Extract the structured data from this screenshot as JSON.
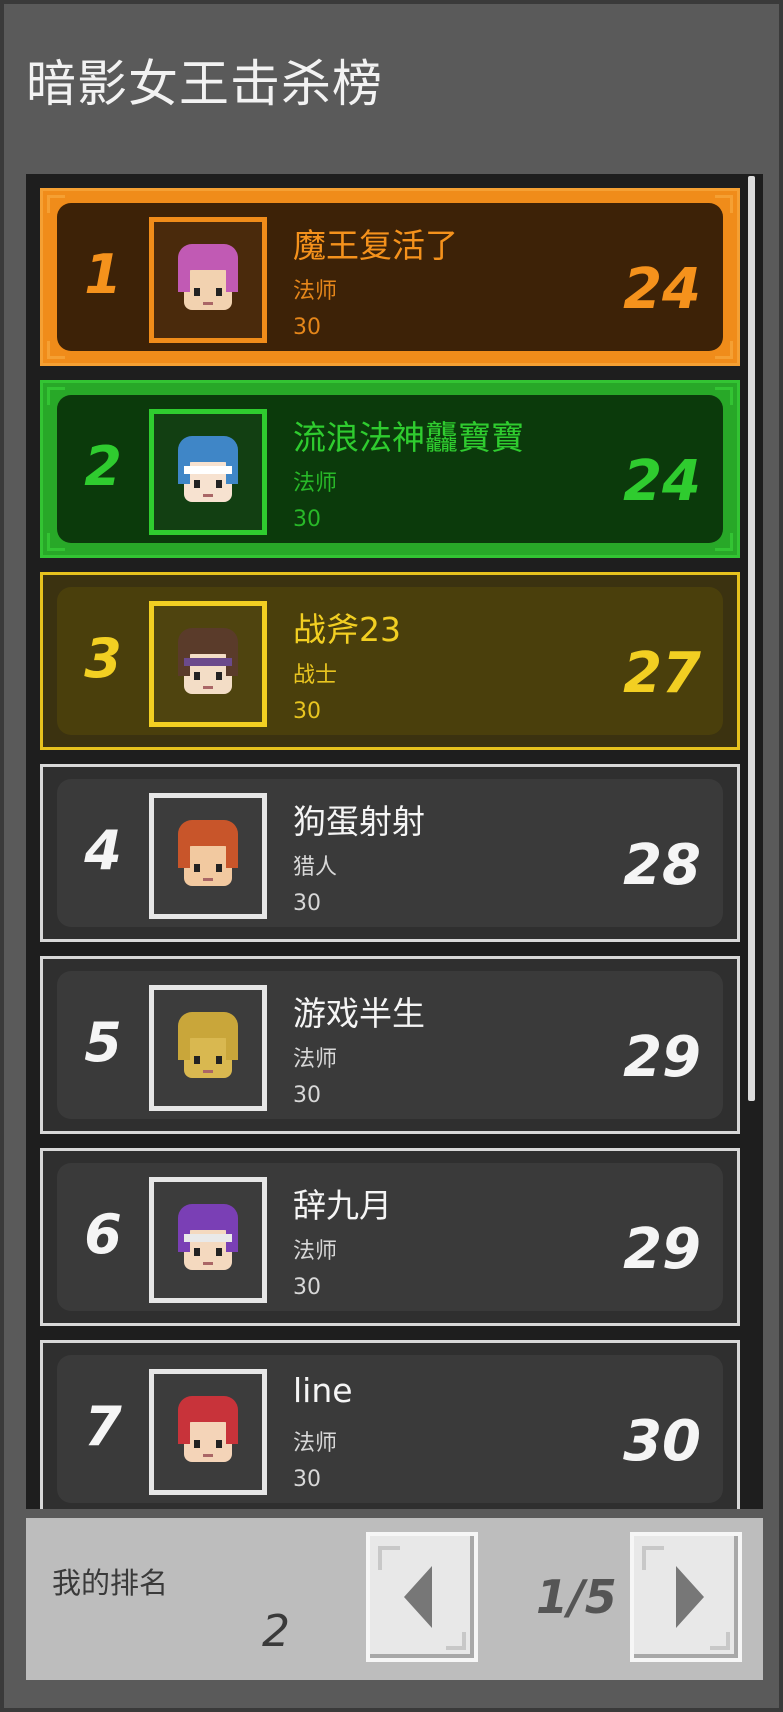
{
  "title": "暗影女王击杀榜",
  "entries": [
    {
      "rank": "1",
      "name": "魔王复活了",
      "class": "法师",
      "level": "30",
      "score": "24",
      "hair": "#c15ab4",
      "band": "",
      "face": "#f2d2b0"
    },
    {
      "rank": "2",
      "name": "流浪法神龘寶寶",
      "class": "法师",
      "level": "30",
      "score": "24",
      "hair": "#3f86c7",
      "band": "#ffffff",
      "face": "#f7e2d0"
    },
    {
      "rank": "3",
      "name": "战斧23",
      "class": "战士",
      "level": "30",
      "score": "27",
      "hair": "#5a3b2a",
      "band": "#6b4a8c",
      "face": "#f3ddc6"
    },
    {
      "rank": "4",
      "name": "狗蛋射射",
      "class": "猎人",
      "level": "30",
      "score": "28",
      "hair": "#c8552a",
      "band": "",
      "face": "#f2c9a0"
    },
    {
      "rank": "5",
      "name": "游戏半生",
      "class": "法师",
      "level": "30",
      "score": "29",
      "hair": "#c9a63a",
      "band": "",
      "face": "#d9b850"
    },
    {
      "rank": "6",
      "name": "辞九月",
      "class": "法师",
      "level": "30",
      "score": "29",
      "hair": "#7a3fb5",
      "band": "#e9e9e9",
      "face": "#f4d9bf"
    },
    {
      "rank": "7",
      "name": "line",
      "class": "法师",
      "level": "30",
      "score": "30",
      "hair": "#c8333a",
      "band": "",
      "face": "#f4d4b8"
    }
  ],
  "footer": {
    "my_rank_label": "我的排名",
    "my_rank_value": "2",
    "page_indicator": "1/5"
  },
  "colors": {
    "gold": "#f08c1a",
    "green": "#2fcc2f",
    "yellow": "#f2cf22",
    "white": "#f5f5f5"
  },
  "icons": {
    "prev": "arrow-left-icon",
    "next": "arrow-right-icon"
  }
}
